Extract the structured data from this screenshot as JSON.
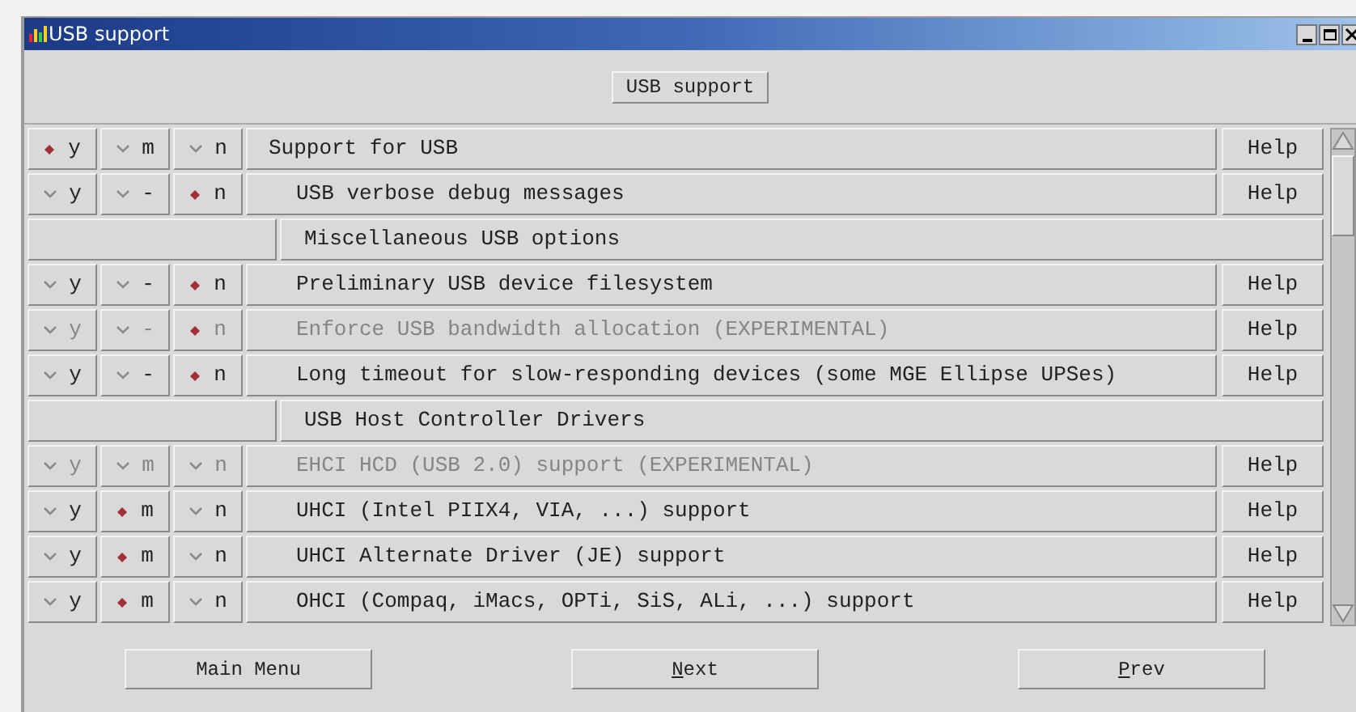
{
  "window": {
    "title": "USB support"
  },
  "section_button": "USB support",
  "rows": [
    {
      "kind": "option",
      "disabled": false,
      "label": "Support for USB",
      "help": "Help",
      "choices": [
        {
          "label": "y",
          "selected": true
        },
        {
          "label": "m",
          "selected": false
        },
        {
          "label": "n",
          "selected": false
        }
      ],
      "children": [
        {
          "kind": "option",
          "disabled": false,
          "label": "USB verbose debug messages",
          "help": "Help",
          "choices": [
            {
              "label": "y",
              "selected": false
            },
            {
              "label": "-",
              "selected": false
            },
            {
              "label": "n",
              "selected": true
            }
          ]
        },
        {
          "kind": "header",
          "label": "Miscellaneous USB options"
        },
        {
          "kind": "option",
          "disabled": false,
          "label": "Preliminary USB device filesystem",
          "help": "Help",
          "choices": [
            {
              "label": "y",
              "selected": false
            },
            {
              "label": "-",
              "selected": false
            },
            {
              "label": "n",
              "selected": true
            }
          ]
        },
        {
          "kind": "option",
          "disabled": true,
          "label": "Enforce USB bandwidth allocation (EXPERIMENTAL)",
          "help": "Help",
          "choices": [
            {
              "label": "y",
              "selected": false
            },
            {
              "label": "-",
              "selected": false
            },
            {
              "label": "n",
              "selected": true
            }
          ]
        },
        {
          "kind": "option",
          "disabled": false,
          "label": "Long timeout for slow-responding devices (some MGE Ellipse UPSes)",
          "help": "Help",
          "choices": [
            {
              "label": "y",
              "selected": false
            },
            {
              "label": "-",
              "selected": false
            },
            {
              "label": "n",
              "selected": true
            }
          ]
        },
        {
          "kind": "header",
          "label": "USB Host Controller Drivers"
        },
        {
          "kind": "option",
          "disabled": true,
          "label": "EHCI HCD (USB 2.0) support (EXPERIMENTAL)",
          "help": "Help",
          "choices": [
            {
              "label": "y",
              "selected": false
            },
            {
              "label": "m",
              "selected": false
            },
            {
              "label": "n",
              "selected": false
            }
          ]
        },
        {
          "kind": "option",
          "disabled": false,
          "label": "UHCI (Intel PIIX4, VIA, ...) support",
          "help": "Help",
          "choices": [
            {
              "label": "y",
              "selected": false
            },
            {
              "label": "m",
              "selected": true
            },
            {
              "label": "n",
              "selected": false
            }
          ]
        },
        {
          "kind": "option",
          "disabled": false,
          "label": "UHCI Alternate Driver (JE) support",
          "help": "Help",
          "choices": [
            {
              "label": "y",
              "selected": false
            },
            {
              "label": "m",
              "selected": true
            },
            {
              "label": "n",
              "selected": false
            }
          ]
        },
        {
          "kind": "option",
          "disabled": false,
          "label": "OHCI (Compaq, iMacs, OPTi, SiS, ALi, ...) support",
          "help": "Help",
          "choices": [
            {
              "label": "y",
              "selected": false
            },
            {
              "label": "m",
              "selected": true
            },
            {
              "label": "n",
              "selected": false
            }
          ]
        }
      ]
    }
  ],
  "buttons": [
    {
      "label": "Main Menu",
      "mnemonic": false
    },
    {
      "label": "Next",
      "mnemonic": true
    },
    {
      "label": "Prev",
      "mnemonic": true
    }
  ]
}
